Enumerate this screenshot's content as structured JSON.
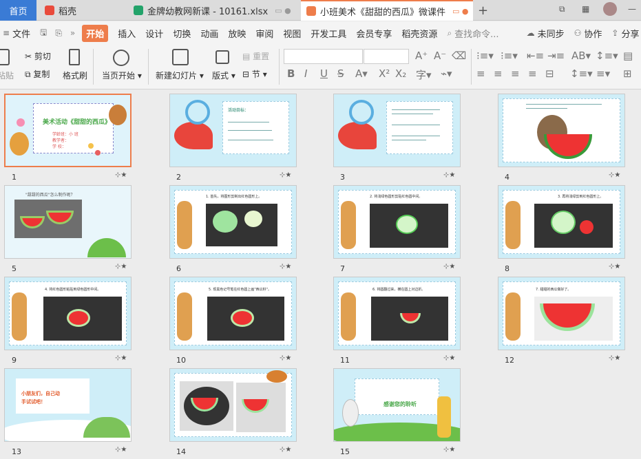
{
  "tabs": {
    "home": "首页",
    "t1": "稻壳",
    "t2": "金牌幼教网新课 - 10161.xlsx",
    "t3": "小班美术《甜甜的西瓜》微课件"
  },
  "menu": {
    "file": "文件",
    "items": [
      "开始",
      "插入",
      "设计",
      "切换",
      "动画",
      "放映",
      "审阅",
      "视图",
      "开发工具",
      "会员专享",
      "稻壳资源"
    ],
    "search": "查找命令...",
    "sync": "未同步",
    "collab": "协作",
    "share": "分享"
  },
  "ribbon": {
    "paste": "粘贴",
    "cut": "剪切",
    "copy": "复制",
    "format_painter": "格式刷",
    "play_from_current": "当页开始",
    "new_slide": "新建幻灯片",
    "layout": "版式",
    "reset": "重置",
    "section": "节"
  },
  "slides": [
    {
      "n": "1",
      "title": "美术活动《甜甜的西瓜》",
      "subs": [
        "学龄班：小 班",
        "教学者：",
        "学  校："
      ]
    },
    {
      "n": "2",
      "title": "活动目标："
    },
    {
      "n": "3"
    },
    {
      "n": "4"
    },
    {
      "n": "5",
      "title": "\"甜甜的西瓜\"怎么制作呢？"
    },
    {
      "n": "6",
      "title": "1. 首先，将图形剪制出红色圆形上。"
    },
    {
      "n": "7",
      "title": "2. 将浅绿色圆形剪贴红色圆中间。"
    },
    {
      "n": "8",
      "title": "3. 再将浅绿剪到红色圆形上。"
    },
    {
      "n": "9",
      "title": "4. 将红色圆形粘贴到绿色圆形中间。"
    },
    {
      "n": "10",
      "title": "5. 现黑色记号笔在红色圆上画\"西瓜籽\"。"
    },
    {
      "n": "11",
      "title": "6. 将圆翻过来，横在圆上对边折。"
    },
    {
      "n": "12",
      "title": "7. 甜甜的西瓜做好了。"
    },
    {
      "n": "13",
      "title": "小朋友们，自己动手试试吧！"
    },
    {
      "n": "14"
    },
    {
      "n": "15",
      "title": "感谢您的聆听"
    }
  ],
  "colors": {
    "accent": "#ee7d4b",
    "blue": "#3a7bd5"
  }
}
